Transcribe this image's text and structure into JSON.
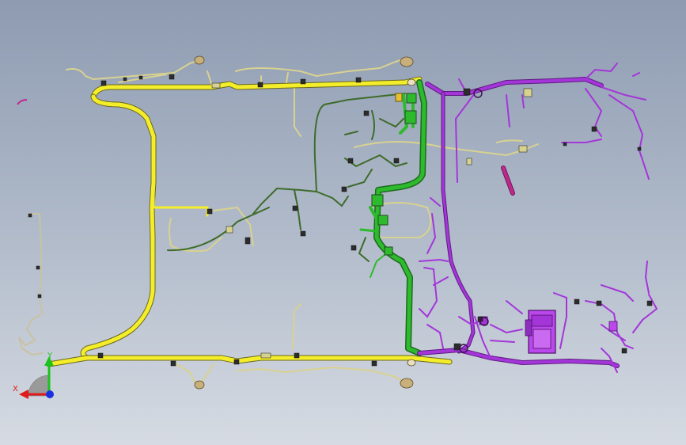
{
  "viewport": {
    "background_top": "#8e9bb1",
    "background_bottom": "#d6dbe3"
  },
  "model": {
    "description_icon": "wire-harness-assembly-3d-model",
    "harness_colors": {
      "yellow": "#f4ee2a",
      "pale_yellow": "#efe9a6",
      "green": "#2dbb2d",
      "dark_green": "#3e6b2a",
      "purple": "#a436d9",
      "magenta": "#c0288e",
      "tan": "#c9c2a2",
      "connector_dark": "#2c2c2c"
    }
  },
  "triad": {
    "x_label": "X",
    "y_label": "Y",
    "x_color": "#e01b1b",
    "y_color": "#1bc41b",
    "z_color": "#1b2fe0"
  }
}
